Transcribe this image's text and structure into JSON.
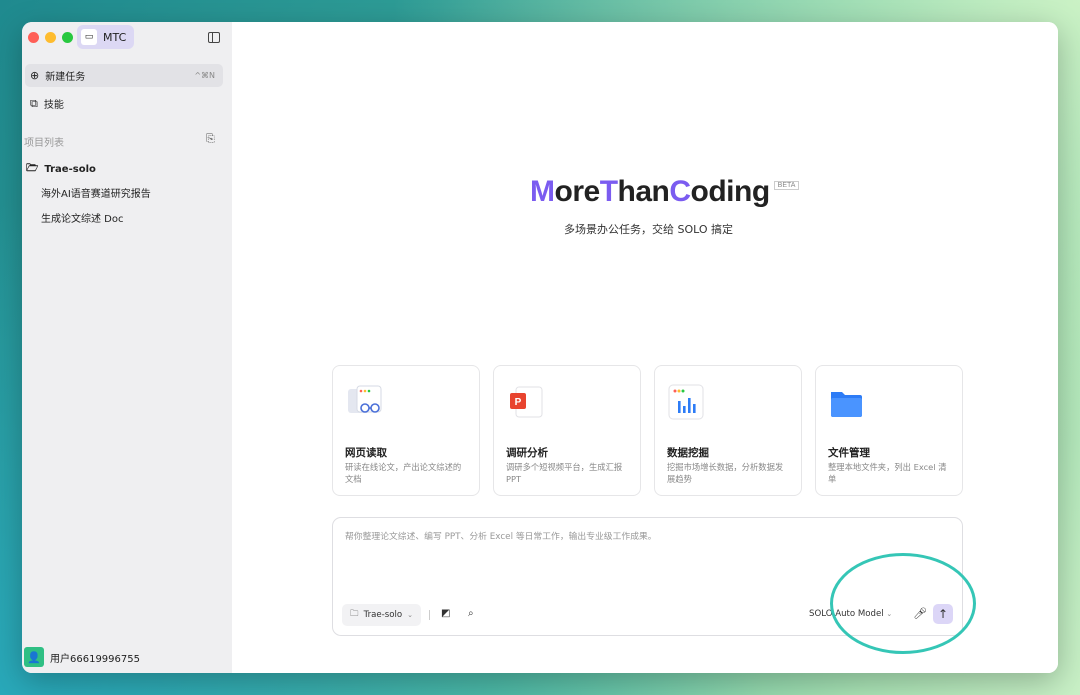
{
  "app": {
    "project_pill": "MTC"
  },
  "sidebar": {
    "new_task": {
      "label": "新建任务",
      "shortcut": "^⌘N"
    },
    "skills": {
      "label": "技能"
    },
    "section_label": "项目列表",
    "project": "Trae-solo",
    "children": [
      "海外AI语音赛道研究报告",
      "生成论文综述 Doc"
    ],
    "user": "用户66619996755"
  },
  "hero": {
    "title_parts": [
      "M",
      "ore ",
      "T",
      "han ",
      "C",
      "oding"
    ],
    "beta": "BETA",
    "subtitle": "多场景办公任务，交给 SOLO 搞定"
  },
  "cards": [
    {
      "title": "网页读取",
      "desc": "研读在线论文，产出论文综述的文档",
      "icon": "web-reader-icon"
    },
    {
      "title": "调研分析",
      "desc": "调研多个短视频平台，生成汇报PPT",
      "icon": "ppt-icon"
    },
    {
      "title": "数据挖掘",
      "desc": "挖掘市场增长数据，分析数据发展趋势",
      "icon": "chart-icon"
    },
    {
      "title": "文件管理",
      "desc": "整理本地文件夹，列出 Excel 清单",
      "icon": "folder-icon"
    }
  ],
  "composer": {
    "placeholder": "帮你整理论文综述、编写 PPT、分析 Excel 等日常工作，输出专业级工作成果。",
    "project_select": "Trae-solo",
    "model": "SOLO Auto Model"
  },
  "colors": {
    "accent": "#7b5cf0",
    "ring": "#35c6b6"
  }
}
